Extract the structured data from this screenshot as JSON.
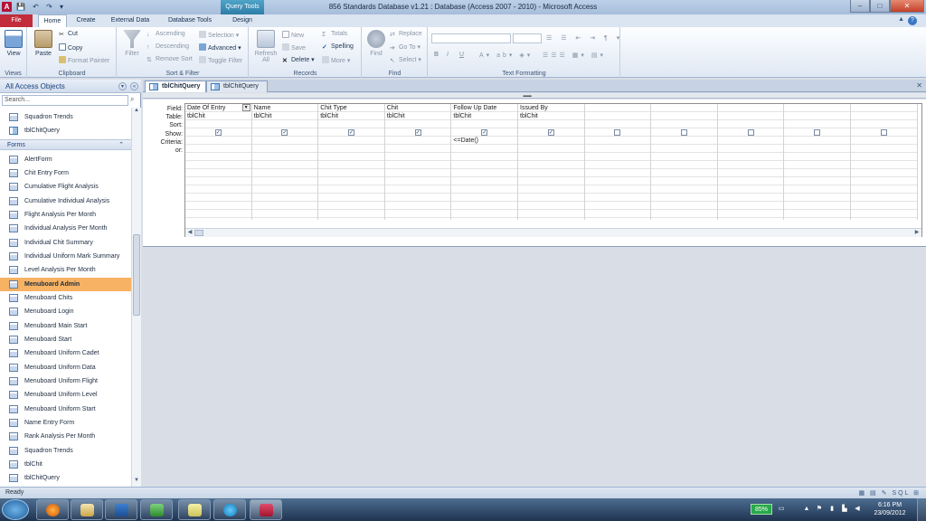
{
  "window": {
    "title": "856 Standards Database v1.21 : Database (Access 2007 - 2010)  -  Microsoft Access",
    "context_tab": "Query Tools",
    "app_letter": "A",
    "min": "–",
    "max": "□",
    "close": "✕"
  },
  "tabs": {
    "file": "File",
    "home": "Home",
    "create": "Create",
    "external": "External Data",
    "dbtools": "Database Tools",
    "design": "Design"
  },
  "ribbon": {
    "views": {
      "view": "View",
      "label": "Views"
    },
    "clipboard": {
      "paste": "Paste",
      "cut": "Cut",
      "copy": "Copy",
      "format_painter": "Format Painter",
      "label": "Clipboard"
    },
    "sort_filter": {
      "filter": "Filter",
      "ascending": "Ascending",
      "descending": "Descending",
      "remove_sort": "Remove Sort",
      "selection": "Selection",
      "advanced": "Advanced",
      "toggle_filter": "Toggle Filter",
      "label": "Sort & Filter"
    },
    "records": {
      "refresh": "Refresh",
      "refresh_all": "All",
      "new": "New",
      "save": "Save",
      "delete": "Delete",
      "totals": "Totals",
      "spelling": "Spelling",
      "more": "More",
      "label": "Records"
    },
    "find": {
      "find": "Find",
      "replace": "Replace",
      "goto": "Go To",
      "select": "Select",
      "label": "Find"
    },
    "text_formatting": {
      "bold": "B",
      "italic": "I",
      "underline": "U",
      "label": "Text Formatting"
    }
  },
  "nav": {
    "title": "All Access Objects",
    "search_placeholder": "Search...",
    "top_items": [
      "Squadron Trends",
      "tblChitQuery"
    ],
    "group": "Forms",
    "forms": [
      "AlertForm",
      "Chit Entry Form",
      "Cumulative Flight Analysis",
      "Cumulative Individual Analysis",
      "Flight Analysis Per Month",
      "Individual Analysis Per Month",
      "Individual Chit Summary",
      "Individual Uniform Mark Summary",
      "Level Analysis Per Month",
      "Menuboard Admin",
      "Menuboard Chits",
      "Menuboard Login",
      "Menuboard Main Start",
      "Menuboard Start",
      "Menuboard Uniform Cadet",
      "Menuboard Uniform Data",
      "Menuboard Uniform Flight",
      "Menuboard Uniform Level",
      "Menuboard Uniform Start",
      "Name Entry Form",
      "Rank Analysis Per Month",
      "Squadron Trends",
      "tblChit",
      "tblChitQuery"
    ],
    "selected": "Menuboard Admin"
  },
  "doc_tabs": [
    "tblChitQuery",
    "tblChitQuery"
  ],
  "grid": {
    "row_labels": [
      "Field:",
      "Table:",
      "Sort:",
      "Show:",
      "Criteria:",
      "or:"
    ],
    "columns": [
      {
        "field": "Date Of Entry",
        "table": "tblChit",
        "show": true,
        "criteria": ""
      },
      {
        "field": "Name",
        "table": "tblChit",
        "show": true,
        "criteria": ""
      },
      {
        "field": "Chit Type",
        "table": "tblChit",
        "show": true,
        "criteria": ""
      },
      {
        "field": "Chit",
        "table": "tblChit",
        "show": true,
        "criteria": ""
      },
      {
        "field": "Follow Up Date",
        "table": "tblChit",
        "show": true,
        "criteria": "<=Date()"
      },
      {
        "field": "Issued By",
        "table": "tblChit",
        "show": true,
        "criteria": ""
      },
      {
        "field": "",
        "table": "",
        "show": false,
        "criteria": ""
      },
      {
        "field": "",
        "table": "",
        "show": false,
        "criteria": ""
      },
      {
        "field": "",
        "table": "",
        "show": false,
        "criteria": ""
      },
      {
        "field": "",
        "table": "",
        "show": false,
        "criteria": ""
      },
      {
        "field": "",
        "table": "",
        "show": false,
        "criteria": ""
      }
    ]
  },
  "status": {
    "text": "Ready",
    "views": "SQL"
  },
  "tray": {
    "battery": "85%",
    "time": "6:16 PM",
    "date": "23/09/2012"
  },
  "colors": {
    "selected_item": "#f7b263",
    "file_tab": "#c22c3b",
    "context_tab": "#2e7ea8"
  }
}
